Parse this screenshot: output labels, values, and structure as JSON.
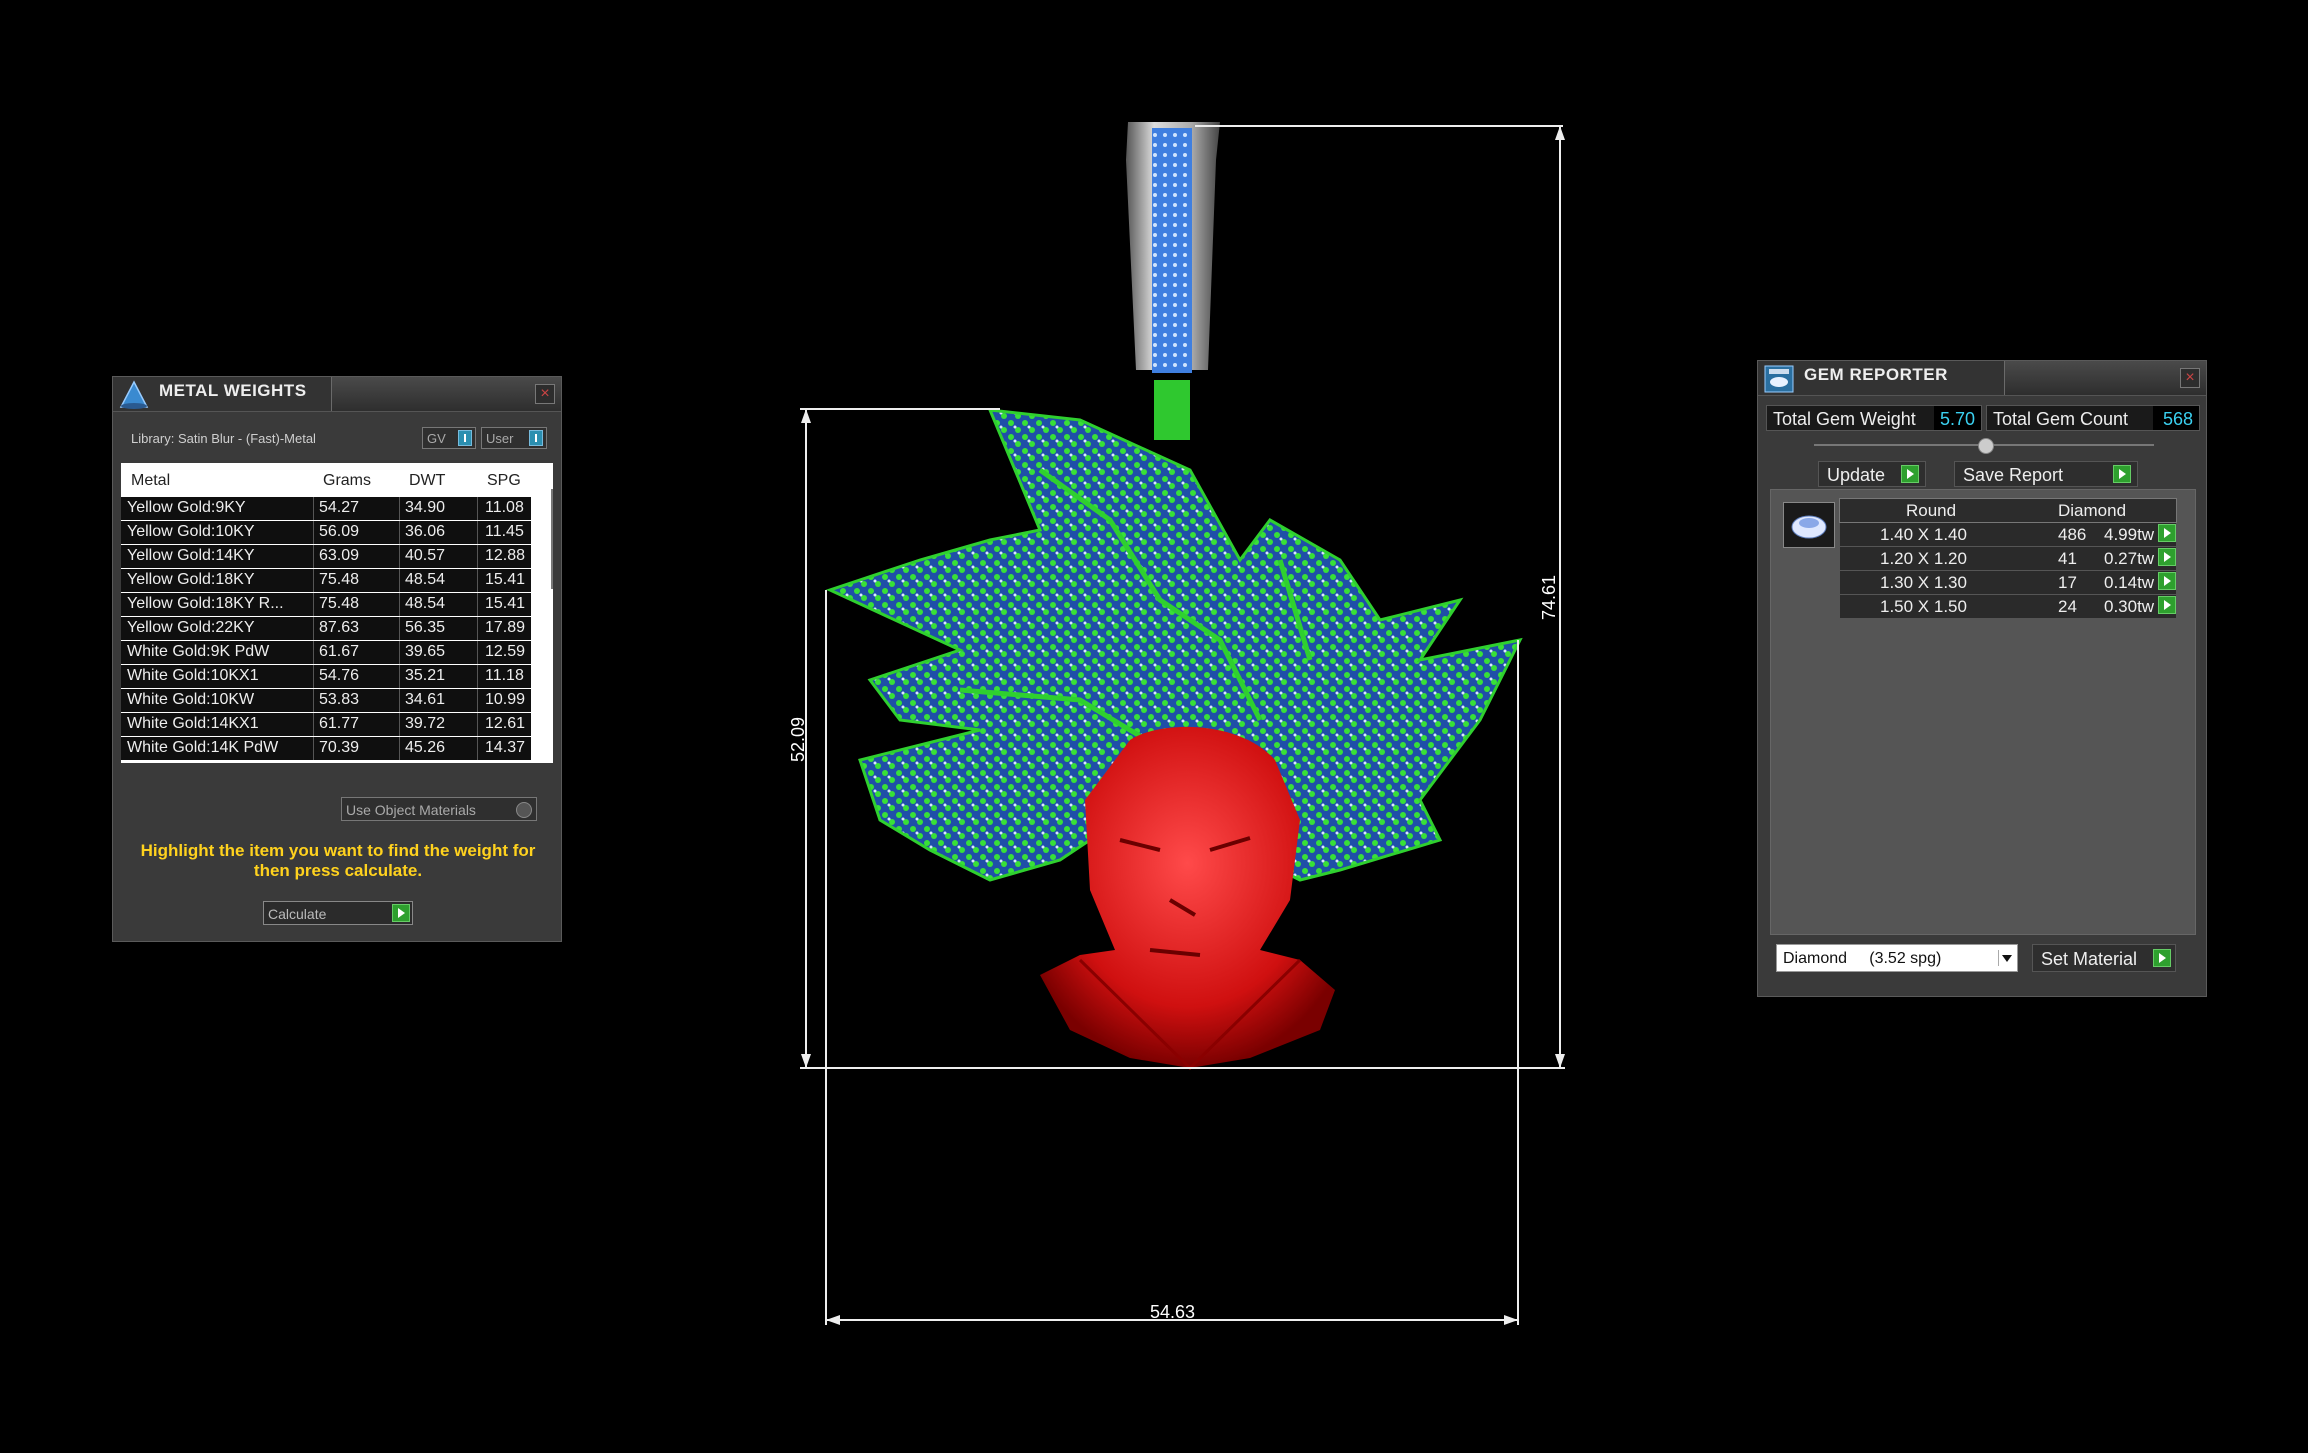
{
  "viewport": {
    "dimensions": {
      "width": "54.63",
      "height_total": "74.61",
      "height_head": "52.09"
    }
  },
  "metal_weights": {
    "title": "METAL WEIGHTS",
    "library": "Library: Satin Blur - (Fast)-Metal",
    "toggle_gv": "GV",
    "toggle_user": "User",
    "columns": [
      "Metal",
      "Grams",
      "DWT",
      "SPG"
    ],
    "rows": [
      [
        "Yellow Gold:9KY",
        "54.27",
        "34.90",
        "11.08"
      ],
      [
        "Yellow Gold:10KY",
        "56.09",
        "36.06",
        "11.45"
      ],
      [
        "Yellow Gold:14KY",
        "63.09",
        "40.57",
        "12.88"
      ],
      [
        "Yellow Gold:18KY",
        "75.48",
        "48.54",
        "15.41"
      ],
      [
        "Yellow Gold:18KY R...",
        "75.48",
        "48.54",
        "15.41"
      ],
      [
        "Yellow Gold:22KY",
        "87.63",
        "56.35",
        "17.89"
      ],
      [
        "White Gold:9K PdW",
        "61.67",
        "39.65",
        "12.59"
      ],
      [
        "White Gold:10KX1",
        "54.76",
        "35.21",
        "11.18"
      ],
      [
        "White Gold:10KW",
        "53.83",
        "34.61",
        "10.99"
      ],
      [
        "White Gold:14KX1",
        "61.77",
        "39.72",
        "12.61"
      ],
      [
        "White Gold:14K PdW",
        "70.39",
        "45.26",
        "14.37"
      ]
    ],
    "use_object_materials": "Use Object Materials",
    "hint": "Highlight the item you want to find the weight for then press calculate.",
    "calculate_label": "Calculate"
  },
  "gem_reporter": {
    "title": "GEM REPORTER",
    "total_weight_label": "Total Gem Weight",
    "total_weight": "5.70",
    "total_count_label": "Total Gem Count",
    "total_count": "568",
    "update_label": "Update",
    "save_report_label": "Save Report",
    "table_head": {
      "shape": "Round",
      "material": "Diamond"
    },
    "rows": [
      {
        "size": "1.40 X 1.40",
        "count": "486",
        "weight": "4.99tw"
      },
      {
        "size": "1.20 X 1.20",
        "count": "41",
        "weight": "0.27tw"
      },
      {
        "size": "1.30 X 1.30",
        "count": "17",
        "weight": "0.14tw"
      },
      {
        "size": "1.50 X 1.50",
        "count": "24",
        "weight": "0.30tw"
      }
    ],
    "material_select": "Diamond     (3.52 spg)",
    "set_material_label": "Set Material"
  }
}
